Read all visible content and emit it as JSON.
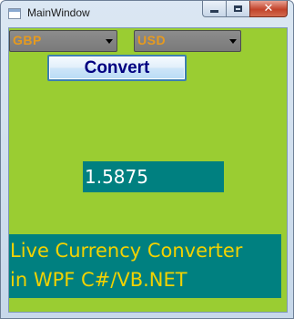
{
  "window": {
    "title": "MainWindow",
    "buttons": {
      "minimize_icon": "minimize-icon",
      "maximize_icon": "maximize-icon",
      "close_icon": "close-icon",
      "close_glyph": "✕"
    }
  },
  "converter": {
    "from_currency": "GBP",
    "to_currency": "USD",
    "convert_label": "Convert",
    "result_value": "1.5875"
  },
  "banner": {
    "line1": "Live Currency Converter",
    "line2": "in WPF C#/VB.NET"
  },
  "colors": {
    "client_background": "#9acd32",
    "teal": "#008080",
    "banner_text": "#f2d200",
    "combo_text": "#e69a1e",
    "button_text": "#000080"
  }
}
